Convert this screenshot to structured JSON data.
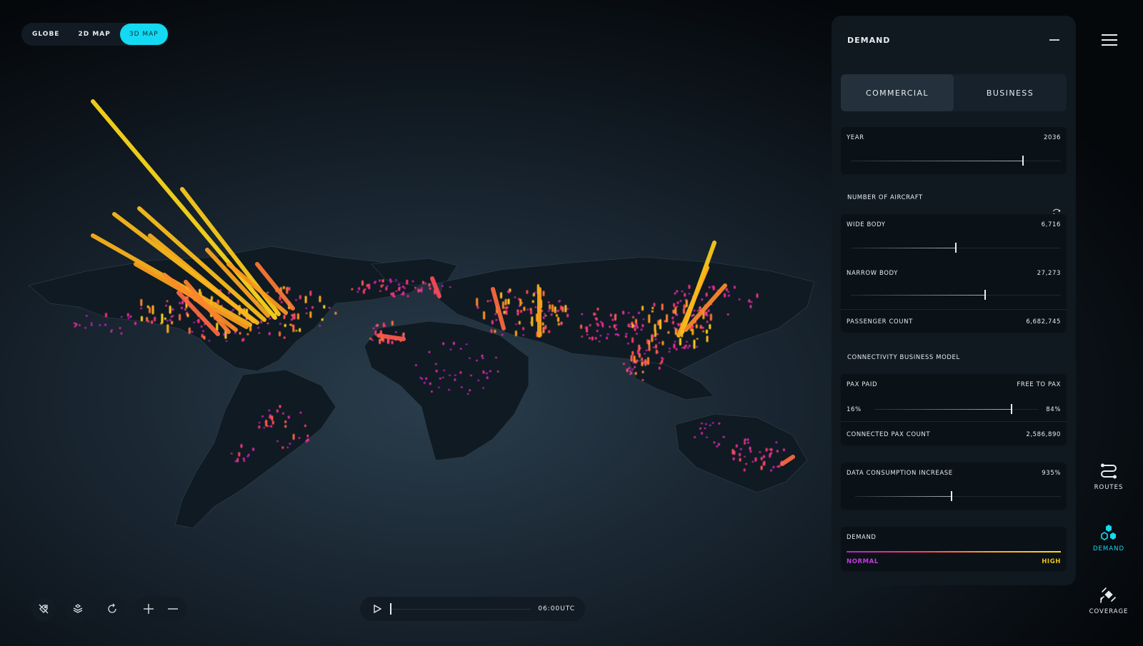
{
  "view_switch": {
    "items": [
      "GLOBE",
      "2D MAP",
      "3D MAP"
    ],
    "active_index": 2
  },
  "panel": {
    "title": "DEMAND",
    "tabs": [
      "COMMERCIAL",
      "BUSINESS"
    ],
    "active_tab": 0,
    "year": {
      "label": "YEAR",
      "value": "2036",
      "level": 0.82
    },
    "aircraft_section": "NUMBER OF AIRCRAFT",
    "wide_body": {
      "label": "WIDE BODY",
      "value": "6,716",
      "level": 0.5
    },
    "narrow_body": {
      "label": "NARROW BODY",
      "value": "27,273",
      "level": 0.64
    },
    "passenger_count": {
      "label": "PASSENGER COUNT",
      "value": "6,682,745"
    },
    "connectivity_section": "CONNECTIVITY BUSINESS MODEL",
    "connectivity": {
      "left_label": "PAX PAID",
      "right_label": "FREE TO PAX",
      "left_value": "16%",
      "right_value": "84%",
      "level": 0.84,
      "connected_label": "CONNECTED PAX COUNT",
      "connected_value": "2,586,890"
    },
    "data_consumption": {
      "label": "DATA CONSUMPTION INCREASE",
      "value": "935%",
      "level": 0.47
    },
    "legend": {
      "title": "DEMAND",
      "low": "NORMAL",
      "high": "HIGH"
    }
  },
  "timeline": {
    "time": "06:00UTC",
    "progress": 0.0
  },
  "rail": [
    {
      "label": "ROUTES",
      "icon": "routes-icon"
    },
    {
      "label": "DEMAND",
      "icon": "demand-icon",
      "active": true
    },
    {
      "label": "COVERAGE",
      "icon": "coverage-icon"
    }
  ],
  "colors": {
    "accent": "#14d9f2",
    "demand_low": "#c21cd6",
    "demand_mid": "#ff9a1e",
    "demand_high": "#ffdb1a",
    "land": "#0f1a22",
    "background": "#18242f"
  }
}
